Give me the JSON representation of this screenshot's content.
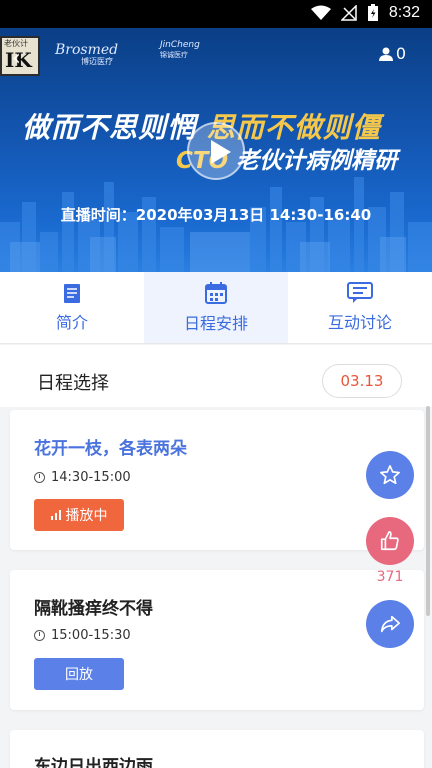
{
  "status_bar": {
    "time": "8:32"
  },
  "banner": {
    "brand1_en": "Brosmed",
    "brand1_cn": "博迈医疗",
    "brand2_en": "JinCheng",
    "brand2_cn": "锦诚医疗",
    "viewer_count": "0",
    "title_line1_white": "做而不思则惘",
    "title_line1_gold": "思而不做则僵",
    "title_line2_gold": "CTO",
    "title_line2_white": "老伙计病例精研",
    "live_time": "直播时间：2020年03月13日 14:30-16:40"
  },
  "tabs": [
    {
      "label": "简介",
      "icon": "document-icon"
    },
    {
      "label": "日程安排",
      "icon": "calendar-icon",
      "active": true
    },
    {
      "label": "互动讨论",
      "icon": "chat-icon"
    }
  ],
  "schedule": {
    "title": "日程选择",
    "date": "03.13"
  },
  "cards": [
    {
      "title": "花开一枝，各表两朵",
      "time": "14:30-15:00",
      "button": "播放中",
      "state": "playing"
    },
    {
      "title": "隔靴搔痒终不得",
      "time": "15:00-15:30",
      "button": "回放",
      "state": "replay"
    },
    {
      "title": "东边日出西边雨"
    }
  ],
  "actions": {
    "like_count": "371"
  },
  "colors": {
    "accent": "#3a6be0",
    "playing": "#f0663d",
    "replay": "#5b80e8",
    "like": "#e8687e"
  }
}
